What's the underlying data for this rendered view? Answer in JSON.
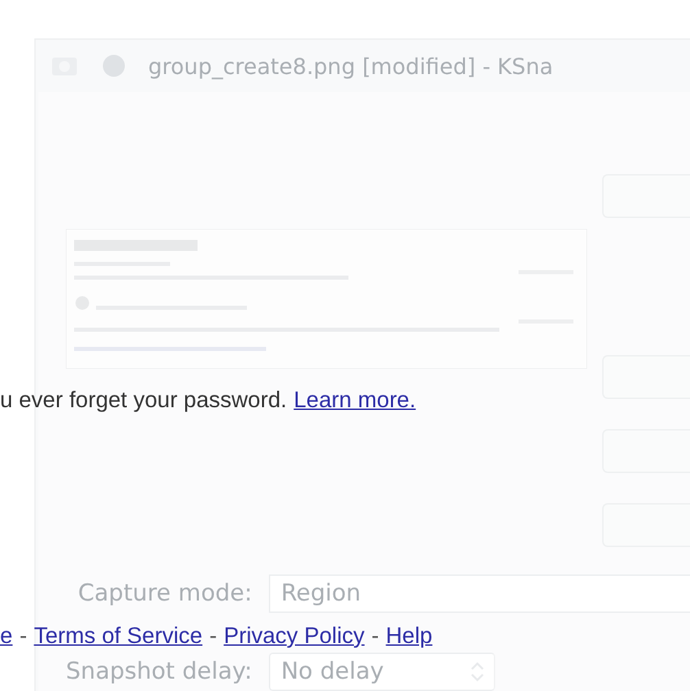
{
  "ghost_window": {
    "title": "group_create8.png [modified] - KSna",
    "capture_mode": {
      "label": "Capture mode:",
      "value": "Region"
    },
    "snapshot_delay": {
      "label": "Snapshot delay:",
      "value": "No delay"
    }
  },
  "page": {
    "notice": "u ever forget your password.",
    "notice_link": "Learn more.",
    "footer": [
      {
        "kind": "link",
        "text": "e"
      },
      {
        "kind": "separator",
        "text": "-"
      },
      {
        "kind": "link",
        "text": "Terms of Service"
      },
      {
        "kind": "separator",
        "text": "-"
      },
      {
        "kind": "link",
        "text": "Privacy Policy"
      },
      {
        "kind": "separator",
        "text": "-"
      },
      {
        "kind": "link",
        "text": "Help"
      }
    ]
  }
}
